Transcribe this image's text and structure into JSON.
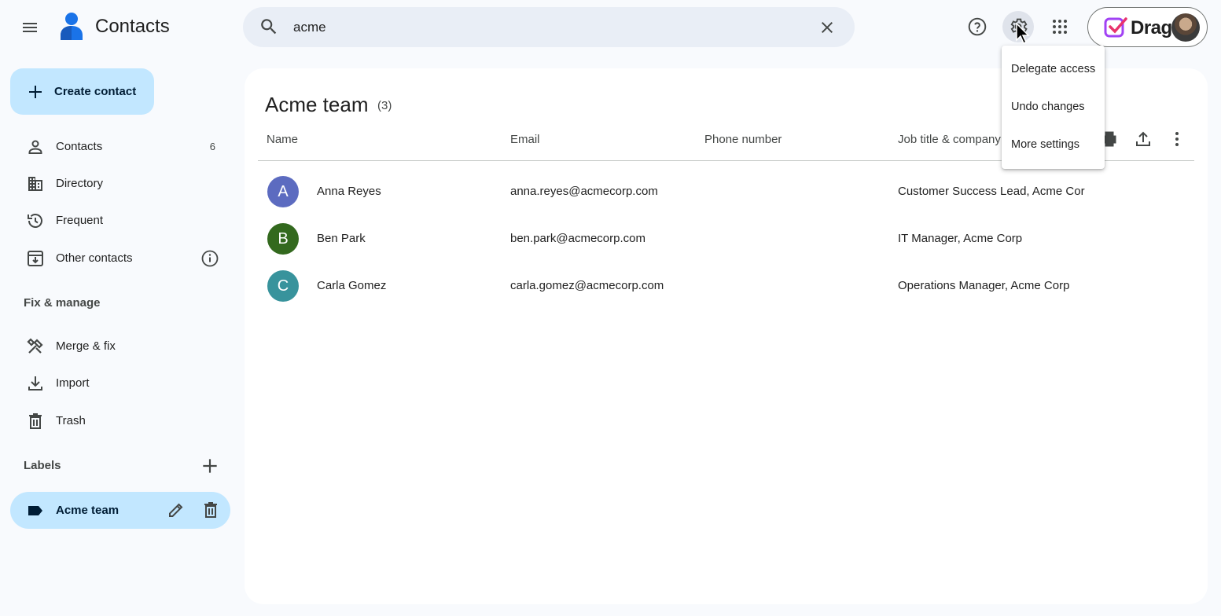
{
  "header": {
    "app_title": "Contacts",
    "search": {
      "value": "acme",
      "placeholder": "Search"
    }
  },
  "sidebar": {
    "create_label": "Create contact",
    "items": [
      {
        "label": "Contacts",
        "count": "6",
        "icon": "person-icon"
      },
      {
        "label": "Directory",
        "icon": "building-icon"
      },
      {
        "label": "Frequent",
        "icon": "history-icon"
      },
      {
        "label": "Other contacts",
        "icon": "archive-icon"
      }
    ],
    "fix_manage_heading": "Fix & manage",
    "fix_items": [
      {
        "label": "Merge & fix",
        "icon": "tools-icon"
      },
      {
        "label": "Import",
        "icon": "download-icon"
      },
      {
        "label": "Trash",
        "icon": "trash-icon"
      }
    ],
    "labels_heading": "Labels",
    "labels": [
      {
        "label": "Acme team"
      }
    ]
  },
  "main": {
    "title": "Acme team",
    "count": "(3)",
    "columns": {
      "name": "Name",
      "email": "Email",
      "phone": "Phone number",
      "job": "Job title & company"
    },
    "rows": [
      {
        "initial": "A",
        "name": "Anna Reyes",
        "email": "anna.reyes@acmecorp.com",
        "phone": "",
        "job": "Customer Success Lead, Acme Corp",
        "color": "#5c6bc0"
      },
      {
        "initial": "B",
        "name": "Ben Park",
        "email": "ben.park@acmecorp.com",
        "phone": "",
        "job": "IT Manager, Acme Corp",
        "color": "#33691e"
      },
      {
        "initial": "C",
        "name": "Carla Gomez",
        "email": "carla.gomez@acmecorp.com",
        "phone": "",
        "job": "Operations Manager, Acme Corp",
        "color": "#38939c"
      }
    ]
  },
  "settings_menu": {
    "items": [
      "Delegate access",
      "Undo changes",
      "More settings"
    ]
  },
  "account": {
    "extension_label": "Drag"
  },
  "colors": {
    "accent": "#c2e7ff",
    "background": "#f8fafd",
    "search_bg": "#e9eef6"
  }
}
